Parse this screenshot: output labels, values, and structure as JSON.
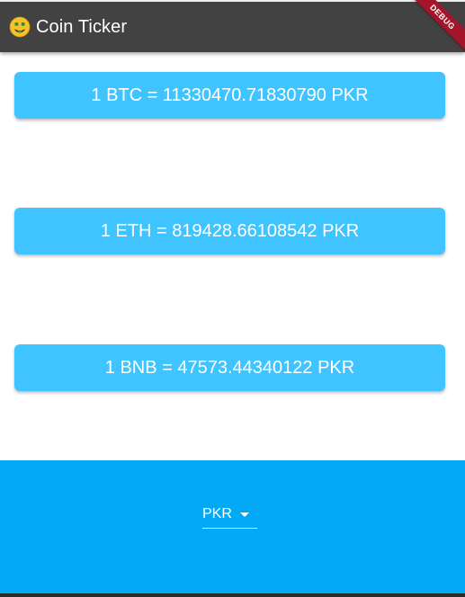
{
  "appbar": {
    "title": "Coin Ticker",
    "title_icon": "money-mouth-face-emoji",
    "debug_banner": "DEBUG",
    "background_color": "#424242"
  },
  "rates": [
    {
      "crypto": "BTC",
      "text": "1 BTC = 11330470.71830790 PKR"
    },
    {
      "crypto": "ETH",
      "text": "1 ETH = 819428.66108542 PKR"
    },
    {
      "crypto": "BNB",
      "text": "1 BNB = 47573.44340122 PKR"
    }
  ],
  "currency_picker": {
    "selected": "PKR",
    "arrow_icon": "arrow-drop-down-icon"
  },
  "colors": {
    "card": "#40c4ff",
    "bottom_panel": "#03a9f4",
    "debug_banner": "#a5152a"
  }
}
